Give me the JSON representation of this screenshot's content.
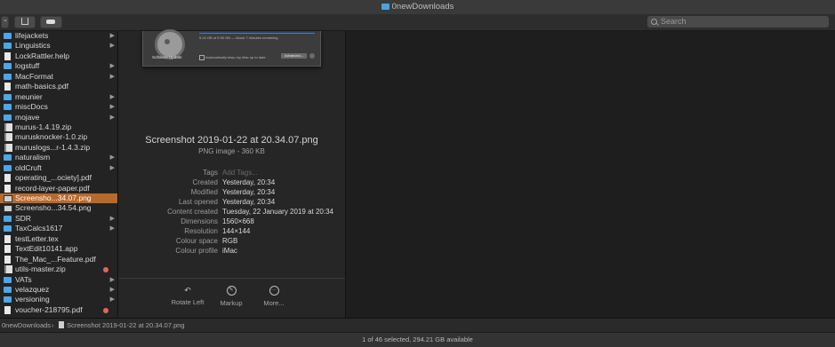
{
  "window": {
    "title": "0newDownloads"
  },
  "search": {
    "placeholder": "Search"
  },
  "files": [
    {
      "name": "lifejackets",
      "type": "folder",
      "chevron": true
    },
    {
      "name": "Linguistics",
      "type": "folder",
      "chevron": true
    },
    {
      "name": "LockRattler.help",
      "type": "file",
      "chevron": false
    },
    {
      "name": "logstuff",
      "type": "folder",
      "chevron": true
    },
    {
      "name": "MacFormat",
      "type": "folder",
      "chevron": true
    },
    {
      "name": "math-basics.pdf",
      "type": "file",
      "chevron": false
    },
    {
      "name": "meunier",
      "type": "folder",
      "chevron": true
    },
    {
      "name": "miscDocs",
      "type": "folder",
      "chevron": true
    },
    {
      "name": "mojave",
      "type": "folder",
      "chevron": true
    },
    {
      "name": "murus-1.4.19.zip",
      "type": "zip",
      "chevron": false
    },
    {
      "name": "murusknocker-1.0.zip",
      "type": "zip",
      "chevron": false
    },
    {
      "name": "muruslogs...r-1.4.3.zip",
      "type": "zip",
      "chevron": false
    },
    {
      "name": "naturalism",
      "type": "folder",
      "chevron": true
    },
    {
      "name": "oldCruft",
      "type": "folder",
      "chevron": true
    },
    {
      "name": "operating_...ociety].pdf",
      "type": "file",
      "chevron": false
    },
    {
      "name": "record-layer-paper.pdf",
      "type": "file",
      "chevron": false
    },
    {
      "name": "Screensho...34.07.png",
      "type": "img",
      "chevron": false,
      "selected": true
    },
    {
      "name": "Screensho...34.54.png",
      "type": "img",
      "chevron": false
    },
    {
      "name": "SDR",
      "type": "folder",
      "chevron": true
    },
    {
      "name": "TaxCalcs1617",
      "type": "folder",
      "chevron": true
    },
    {
      "name": "testLetter.tex",
      "type": "file",
      "chevron": false
    },
    {
      "name": "TextEdit10141.app",
      "type": "file",
      "chevron": false
    },
    {
      "name": "The_Mac_...Feature.pdf",
      "type": "file",
      "chevron": false
    },
    {
      "name": "utils-master.zip",
      "type": "zip",
      "chevron": false,
      "tag": "#e8635a"
    },
    {
      "name": "VATs",
      "type": "folder",
      "chevron": true
    },
    {
      "name": "velazquez",
      "type": "folder",
      "chevron": true
    },
    {
      "name": "versioning",
      "type": "folder",
      "chevron": true
    },
    {
      "name": "voucher-218795.pdf",
      "type": "file",
      "chevron": false,
      "tag": "#e8635a"
    }
  ],
  "thumbnail": {
    "app_label": "Software Update",
    "progress_text": "5.24 GB of 5.93 GB — About 7 minutes remaining",
    "auto_update_text": "Automatically keep my Mac up to date",
    "advanced_label": "Advanced..."
  },
  "preview": {
    "file_name": "Screenshot 2019-01-22 at 20.34.07.png",
    "file_kind": "PNG image - 360 KB",
    "meta": [
      {
        "key": "Tags",
        "value": "Add Tags...",
        "placeholder": true
      },
      {
        "key": "Created",
        "value": "Yesterday, 20:34"
      },
      {
        "key": "Modified",
        "value": "Yesterday, 20:34"
      },
      {
        "key": "Last opened",
        "value": "Yesterday, 20:34"
      },
      {
        "key": "Content created",
        "value": "Tuesday, 22 January 2019 at 20:34"
      },
      {
        "key": "Dimensions",
        "value": "1560×668"
      },
      {
        "key": "Resolution",
        "value": "144×144"
      },
      {
        "key": "Colour space",
        "value": "RGB"
      },
      {
        "key": "Colour profile",
        "value": "iMac"
      }
    ],
    "actions": [
      {
        "label": "Rotate Left",
        "icon": "rotate-left-icon"
      },
      {
        "label": "Markup",
        "icon": "markup-icon"
      },
      {
        "label": "More...",
        "icon": "more-icon"
      }
    ]
  },
  "pathbar": {
    "folder": "0newDownloads",
    "separator": "›",
    "file": "Screenshot 2019-01-22 at 20.34.07.png"
  },
  "status": {
    "text": "1 of 46 selected, 294.21 GB available"
  }
}
